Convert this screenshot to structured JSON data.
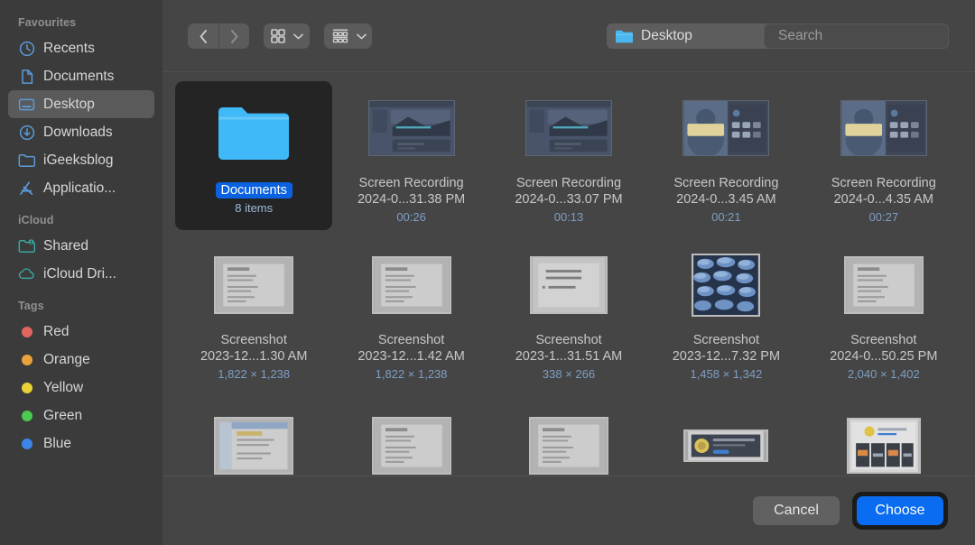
{
  "sidebar": {
    "sections": [
      {
        "title": "Favourites",
        "items": [
          {
            "label": "Recents",
            "icon": "clock-icon",
            "selected": false
          },
          {
            "label": "Documents",
            "icon": "document-icon",
            "selected": false
          },
          {
            "label": "Desktop",
            "icon": "desktop-icon",
            "selected": true
          },
          {
            "label": "Downloads",
            "icon": "download-icon",
            "selected": false
          },
          {
            "label": "iGeeksblog",
            "icon": "folder-icon",
            "selected": false
          },
          {
            "label": "Applicatio...",
            "icon": "applications-icon",
            "selected": false
          }
        ]
      },
      {
        "title": "iCloud",
        "items": [
          {
            "label": "Shared",
            "icon": "shared-folder-icon",
            "selected": false
          },
          {
            "label": "iCloud Dri...",
            "icon": "cloud-icon",
            "selected": false
          }
        ]
      },
      {
        "title": "Tags",
        "items": [
          {
            "label": "Red",
            "icon": "tag-dot-icon",
            "color": "#e0665f",
            "selected": false
          },
          {
            "label": "Orange",
            "icon": "tag-dot-icon",
            "color": "#e8a33d",
            "selected": false
          },
          {
            "label": "Yellow",
            "icon": "tag-dot-icon",
            "color": "#e9d138",
            "selected": false
          },
          {
            "label": "Green",
            "icon": "tag-dot-icon",
            "color": "#4cc94f",
            "selected": false
          },
          {
            "label": "Blue",
            "icon": "tag-dot-icon",
            "color": "#3d86e8",
            "selected": false
          }
        ]
      }
    ]
  },
  "toolbar": {
    "back_icon": "chevron-left-icon",
    "forward_icon": "chevron-right-icon",
    "view_icon": "icon-view-icon",
    "view_chevron": "chevron-down-icon",
    "group_icon": "group-by-icon",
    "group_chevron": "chevron-down-icon",
    "path": {
      "label": "Desktop",
      "folder_icon": "blue-folder-icon",
      "stepper_icon": "up-down-chevron-icon"
    },
    "search": {
      "placeholder": "Search",
      "value": "",
      "icon": "search-icon"
    }
  },
  "files": [
    {
      "name": "Documents",
      "name2": "",
      "meta": "8 items",
      "kind": "folder",
      "selected": true
    },
    {
      "name": "Screen Recording",
      "name2": "2024-0...31.38 PM",
      "meta": "00:26",
      "kind": "recording",
      "selected": false
    },
    {
      "name": "Screen Recording",
      "name2": "2024-0...33.07 PM",
      "meta": "00:13",
      "kind": "recording",
      "selected": false
    },
    {
      "name": "Screen Recording",
      "name2": "2024-0...3.45 AM",
      "meta": "00:21",
      "kind": "recording2",
      "selected": false
    },
    {
      "name": "Screen Recording",
      "name2": "2024-0...4.35 AM",
      "meta": "00:27",
      "kind": "recording2",
      "selected": false
    },
    {
      "name": "Screenshot",
      "name2": "2023-12...1.30 AM",
      "meta": "1,822 × 1,238",
      "kind": "doc",
      "selected": false
    },
    {
      "name": "Screenshot",
      "name2": "2023-12...1.42 AM",
      "meta": "1,822 × 1,238",
      "kind": "doc",
      "selected": false
    },
    {
      "name": "Screenshot",
      "name2": "2023-1...31.51 AM",
      "meta": "338 × 266",
      "kind": "menu",
      "selected": false
    },
    {
      "name": "Screenshot",
      "name2": "2023-12...7.32 PM",
      "meta": "1,458 × 1,342",
      "kind": "photo",
      "selected": false
    },
    {
      "name": "Screenshot",
      "name2": "2024-0...50.25 PM",
      "meta": "2,040 × 1,402",
      "kind": "doc",
      "selected": false
    },
    {
      "name": "",
      "name2": "",
      "meta": "",
      "kind": "doc2",
      "selected": false
    },
    {
      "name": "",
      "name2": "",
      "meta": "",
      "kind": "doc",
      "selected": false
    },
    {
      "name": "",
      "name2": "",
      "meta": "",
      "kind": "doc",
      "selected": false
    },
    {
      "name": "",
      "name2": "",
      "meta": "",
      "kind": "banner",
      "selected": false
    },
    {
      "name": "",
      "name2": "",
      "meta": "",
      "kind": "store",
      "selected": false
    }
  ],
  "footer": {
    "cancel_label": "Cancel",
    "choose_label": "Choose"
  },
  "colors": {
    "accent": "#0a6cf0",
    "sidebar_bg": "#3b3b3b",
    "pane_bg": "#454545",
    "meta_text": "#7e9ec4"
  }
}
